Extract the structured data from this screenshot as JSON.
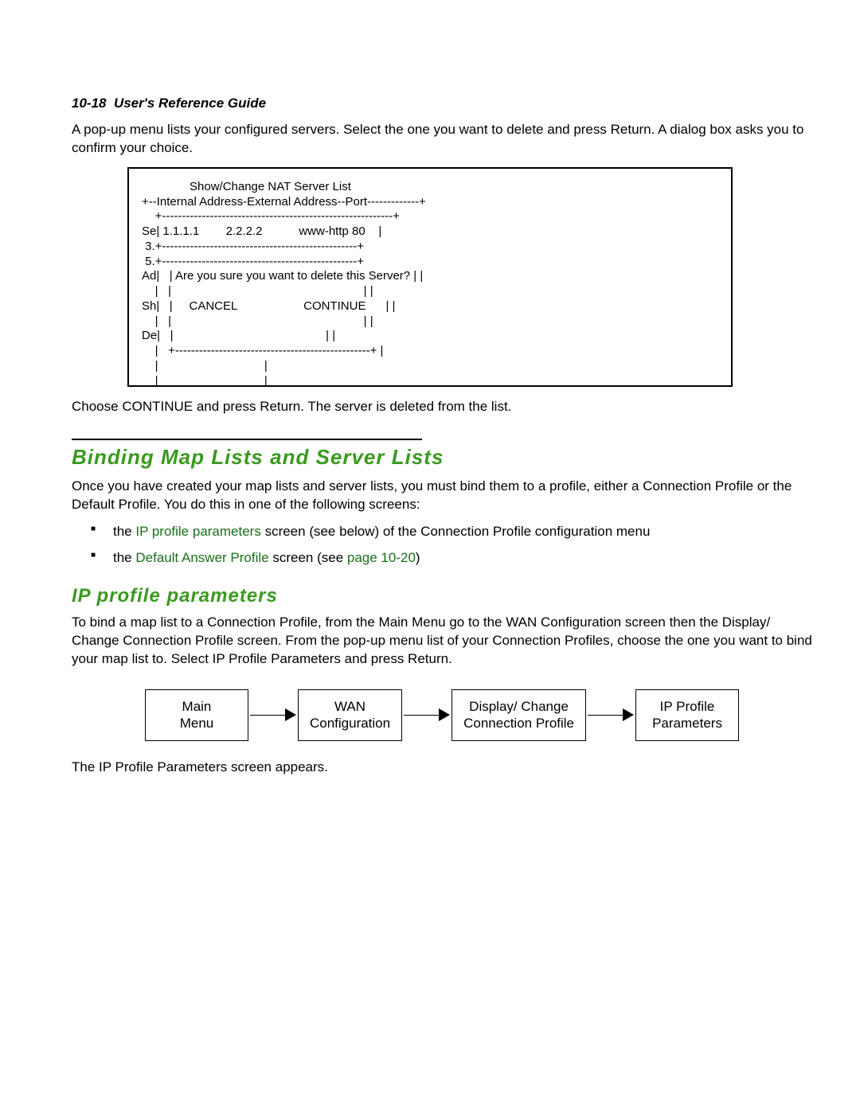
{
  "header": {
    "page_number": "10-18",
    "guide_title": "User's Reference Guide"
  },
  "intro_para": "A pop-up menu lists your configured servers. Select the one you want to delete and press Return. A dialog box asks you to confirm your choice.",
  "terminal": {
    "title": "Show/Change NAT Server List",
    "header_row": "+--Internal Address-External Address--Port-------------+",
    "row_sel": "Se| 1.1.1.1        2.2.2.2           www-http 80    |",
    "row_3": " 3.+-------------------------------------------------+",
    "row_5": " 5.+-------------------------------------------------+",
    "row_ad": "Ad|   | Are you sure you want to delete this Server? | |",
    "row_blank1": "    |   |                                                          | |",
    "row_sh": "Sh|   |     CANCEL                    CONTINUE      | |",
    "row_blank2": "    |   |                                                          | |",
    "row_de": "De|   |                                              | |",
    "row_close": "    |   +-------------------------------------------------+ |",
    "row_mid1": "    |                                |",
    "row_bot": "    +----------------------------------------------------------+"
  },
  "after_terminal": "Choose CONTINUE and press Return. The server is deleted from the list.",
  "section1": {
    "title": "Binding Map Lists and Server Lists",
    "para": "Once you have created your map lists and server lists, you must bind them to a profile, either a Connection Profile or the Default Profile. You do this in one of the following screens:",
    "bullets": [
      {
        "prefix": "the ",
        "link": "IP profile parameters",
        "suffix": " screen (see below) of the Connection Profile configuration menu"
      },
      {
        "prefix": "the ",
        "link": "Default Answer Profile",
        "mid": " screen (see ",
        "link2": "page 10-20",
        "suffix": ")"
      }
    ]
  },
  "section2": {
    "title": "IP profile parameters",
    "para": "To bind a map list to a Connection Profile, from the Main Menu go to the WAN Configuration screen then the Display/ Change Connection Profile screen. From the pop-up menu list of your Connection Profiles, choose the one you want to bind your map list to. Select IP Profile Parameters and press Return.",
    "flow": [
      "Main\nMenu",
      "WAN\nConfiguration",
      "Display/ Change\nConnection Profile",
      "IP Profile\nParameters"
    ],
    "closing": "The IP Profile Parameters screen appears."
  }
}
